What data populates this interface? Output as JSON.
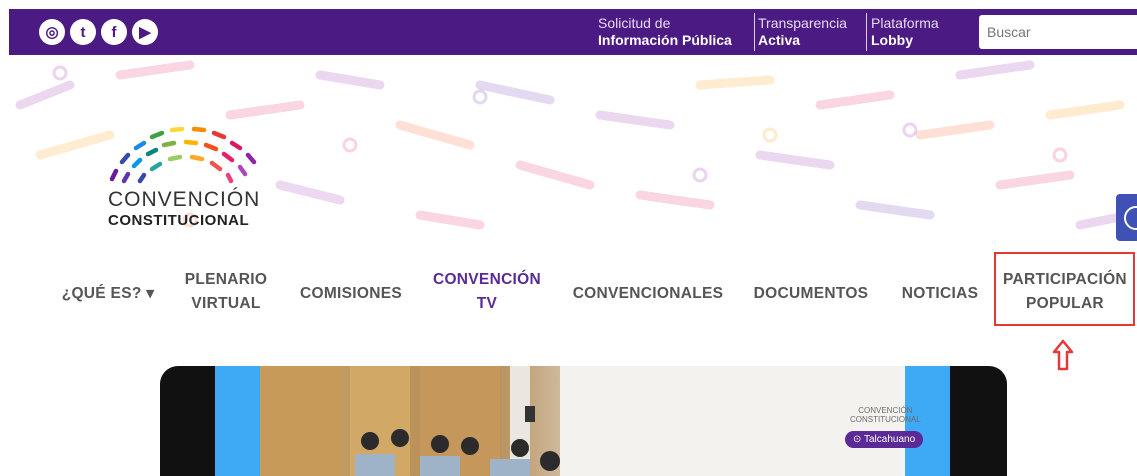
{
  "topbar": {
    "social_icons": [
      "instagram-icon",
      "twitter-icon",
      "facebook-icon",
      "youtube-icon"
    ],
    "social_glyphs": [
      "◎",
      "t",
      "f",
      "▶"
    ],
    "links": [
      {
        "line1": "Solicitud de",
        "line2": "Información Pública"
      },
      {
        "line1": "Transparencia",
        "line2": "Activa"
      },
      {
        "line1": "Plataforma",
        "line2": "Lobby"
      }
    ],
    "search_placeholder": "Buscar"
  },
  "logo": {
    "line1": "CONVENCIÓN",
    "line2": "CONSTITUCIONAL"
  },
  "nav": {
    "items": [
      {
        "line1": "¿QUÉ ES? ▾",
        "line2": ""
      },
      {
        "line1": "PLENARIO",
        "line2": "VIRTUAL"
      },
      {
        "line1": "COMISIONES",
        "line2": ""
      },
      {
        "line1": "CONVENCIÓN",
        "line2": "TV"
      },
      {
        "line1": "CONVENCIONALES",
        "line2": ""
      },
      {
        "line1": "DOCUMENTOS",
        "line2": ""
      },
      {
        "line1": "NOTICIAS",
        "line2": ""
      },
      {
        "line1": "PARTICIPACIÓN",
        "line2": "POPULAR"
      }
    ]
  },
  "video": {
    "mini_logo_line1": "CONVENCIÓN",
    "mini_logo_line2": "CONSTITUCIONAL",
    "location_badge": "Talcahuano"
  },
  "colors": {
    "brand_purple": "#4b1a82",
    "highlight_red": "#e53935",
    "accent_blue": "#3ea9f5"
  }
}
